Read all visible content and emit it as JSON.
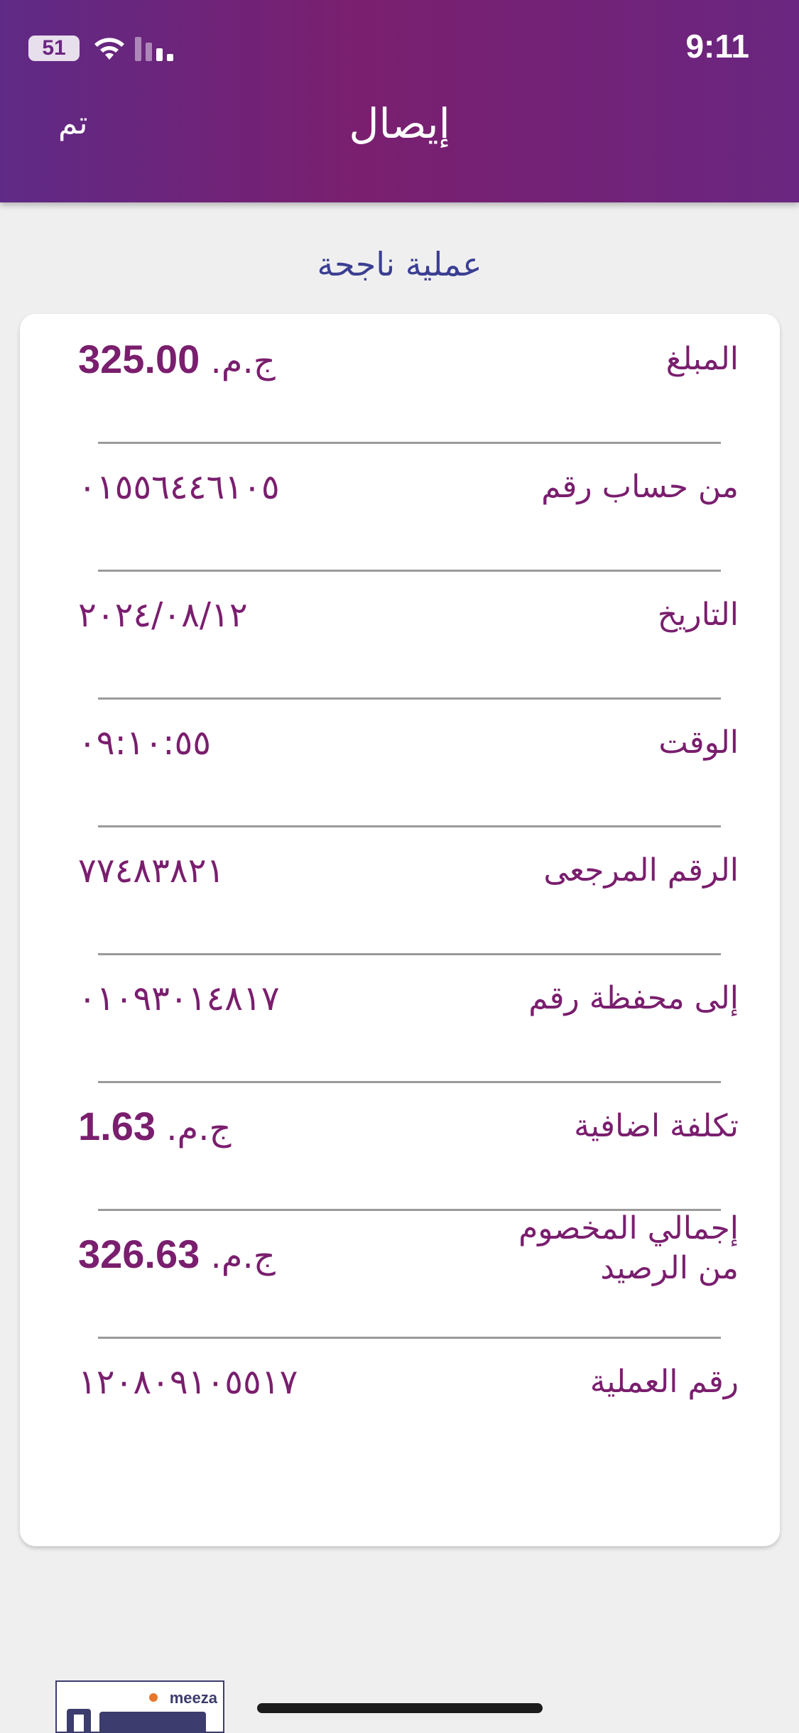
{
  "status_bar": {
    "time": "9:11",
    "battery": "51",
    "icons": [
      "battery-icon",
      "wifi-icon",
      "cellular-signal-icon"
    ]
  },
  "nav": {
    "title": "إيصال",
    "done_label": "تم"
  },
  "receipt": {
    "status_text": "عملية ناجحة",
    "rows": [
      {
        "label": "المبلغ",
        "amount": "325.00",
        "currency": "ج.م."
      },
      {
        "label": "من حساب رقم",
        "value": "٠١٥٥٦٤٤٦١٠٥"
      },
      {
        "label": "التاريخ",
        "value": "٢٠٢٤/٠٨/١٢"
      },
      {
        "label": "الوقت",
        "value": "٠٩:١٠:٥٥"
      },
      {
        "label": "الرقم المرجعى",
        "value": "٧٧٤٨٣٨٢١"
      },
      {
        "label": "إلى محفظة رقم",
        "value": "٠١٠٩٣٠١٤٨١٧"
      },
      {
        "label": "تكلفة اضافية",
        "amount": "1.63",
        "currency": "ج.م."
      },
      {
        "label": "إجمالي المخصوم من الرصيد",
        "amount": "326.63",
        "currency": "ج.م."
      },
      {
        "label": "رقم العملية",
        "value": "١٢٠٨٠٩١٠٥٥١٧"
      }
    ]
  },
  "footer": {
    "logo_text": "meeza"
  },
  "colors": {
    "header_start": "#5f2a86",
    "header_mid": "#7a1f6f",
    "accent": "#7a1e6e",
    "success_title": "#3b3f92",
    "background": "#efefef"
  }
}
